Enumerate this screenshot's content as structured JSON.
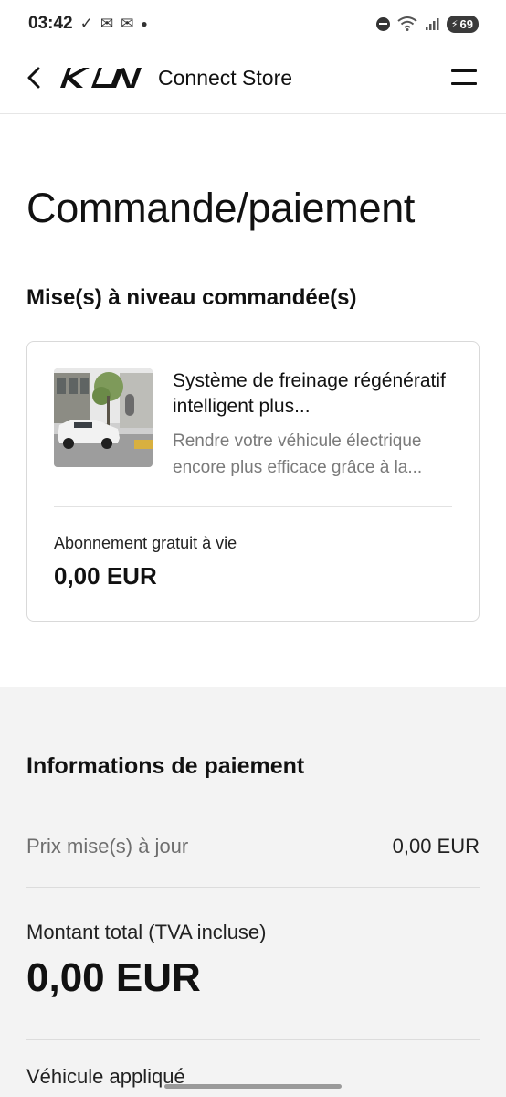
{
  "status_bar": {
    "time": "03:42",
    "battery": "69",
    "icons": [
      "check-icon",
      "mail-icon",
      "mail-icon",
      "dot-icon",
      "dnd-icon",
      "wifi-icon",
      "signal-icon",
      "battery-icon"
    ]
  },
  "header": {
    "brand": "KIA",
    "title": "Connect Store",
    "back_icon": "chevron-left-icon",
    "menu_icon": "menu-icon"
  },
  "page": {
    "title": "Commande/paiement",
    "section_title": "Mise(s) à niveau commandée(s)"
  },
  "order_item": {
    "title": "Système de freinage régénératif intelligent plus...",
    "description": "Rendre votre véhicule électrique encore plus efficace grâce à la...",
    "subscription_label": "Abonnement gratuit à vie",
    "price": "0,00 EUR"
  },
  "payment": {
    "title": "Informations de paiement",
    "updates_price_label": "Prix mise(s) à jour",
    "updates_price_value": "0,00 EUR",
    "total_label": "Montant total (TVA incluse)",
    "total_value": "0,00 EUR",
    "vehicle_label": "Véhicule appliqué"
  },
  "colors": {
    "text": "#111111",
    "muted": "#7a7a7a",
    "gray_bg": "#f3f3f3",
    "border": "#d9d9d9"
  }
}
